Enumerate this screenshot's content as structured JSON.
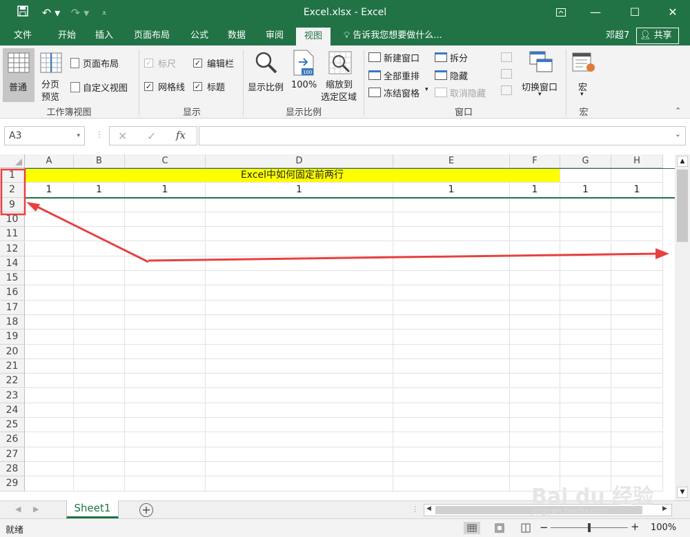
{
  "window": {
    "title": "Excel.xlsx - Excel"
  },
  "tabs": [
    {
      "label": "文件"
    },
    {
      "label": "开始"
    },
    {
      "label": "插入"
    },
    {
      "label": "页面布局"
    },
    {
      "label": "公式"
    },
    {
      "label": "数据"
    },
    {
      "label": "审阅"
    },
    {
      "label": "视图"
    }
  ],
  "tell_me": "告诉我您想要做什么...",
  "user": "邓超7",
  "share": "共享",
  "ribbon": {
    "normal": "普通",
    "page_break_line1": "分页",
    "page_break_line2": "预览",
    "page_layout": "页面布局",
    "custom_views": "自定义视图",
    "group_workbook_views": "工作簿视图",
    "ruler": "标尺",
    "formula_bar": "编辑栏",
    "gridlines": "网格线",
    "headings": "标题",
    "group_show": "显示",
    "zoom": "显示比例",
    "zoom100": "100%",
    "zoom100_badge": "100",
    "zoom_sel_line1": "缩放到",
    "zoom_sel_line2": "选定区域",
    "group_zoom": "显示比例",
    "new_window": "新建窗口",
    "arrange_all": "全部重排",
    "freeze_panes": "冻结窗格",
    "split": "拆分",
    "hide": "隐藏",
    "unhide": "取消隐藏",
    "switch_windows": "切换窗口",
    "group_window": "窗口",
    "macros": "宏",
    "group_macros": "宏"
  },
  "formula_bar": {
    "name_box": "A3",
    "fx": "fx",
    "value": ""
  },
  "columns": [
    "A",
    "B",
    "C",
    "D",
    "E",
    "F",
    "G",
    "H"
  ],
  "rows": [
    "1",
    "2",
    "9",
    "10",
    "11",
    "12",
    "14",
    "15",
    "16",
    "17",
    "18",
    "19",
    "20",
    "21",
    "22",
    "23",
    "24",
    "25",
    "26",
    "27",
    "28",
    "29"
  ],
  "cells": {
    "merged_title": "Excel中如何固定前两行",
    "row2": [
      "1",
      "1",
      "1",
      "1",
      "1",
      "1",
      "1",
      "1"
    ]
  },
  "highlight_color": "#ffff00",
  "annotation_color": "#e84040",
  "sheet_tab": "Sheet1",
  "status": {
    "ready": "就绪",
    "zoom": "100%"
  },
  "watermark": {
    "brand": "Bai du 经验",
    "url": "jingyan.baidu.com"
  }
}
